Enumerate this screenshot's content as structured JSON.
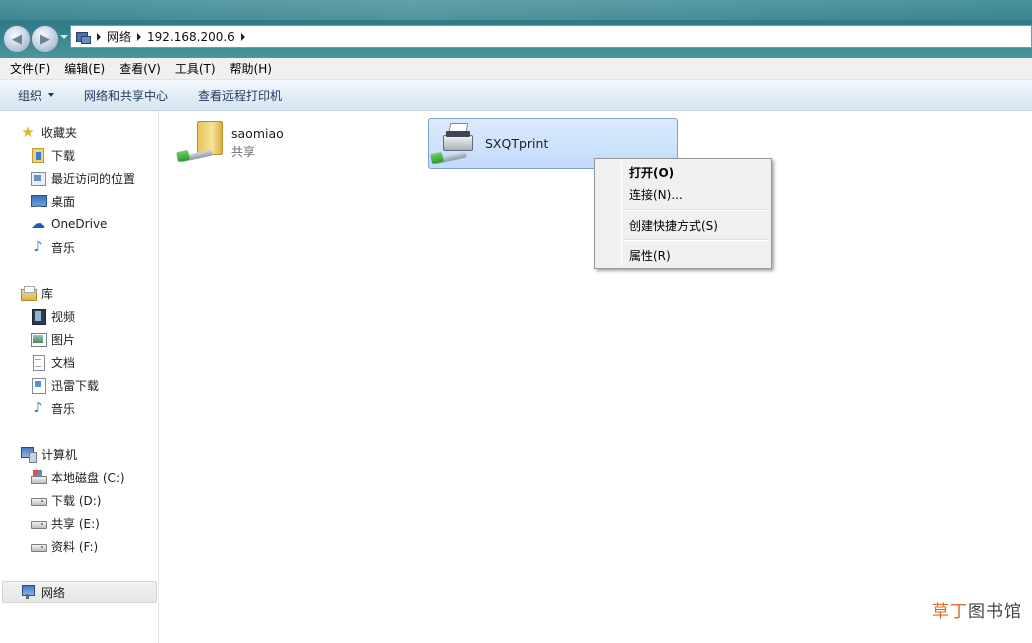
{
  "address": {
    "crumbs": [
      "网络",
      "192.168.200.6"
    ]
  },
  "menubar": {
    "items": [
      "文件(F)",
      "编辑(E)",
      "查看(V)",
      "工具(T)",
      "帮助(H)"
    ]
  },
  "toolbar": {
    "organize": "组织",
    "network_center": "网络和共享中心",
    "view_printers": "查看远程打印机"
  },
  "sidebar": {
    "favorites": {
      "label": "收藏夹",
      "items": [
        "下载",
        "最近访问的位置",
        "桌面",
        "OneDrive",
        "音乐"
      ]
    },
    "libraries": {
      "label": "库",
      "items": [
        "视频",
        "图片",
        "文档",
        "迅雷下载",
        "音乐"
      ]
    },
    "computer": {
      "label": "计算机",
      "items": [
        "本地磁盘 (C:)",
        "下载 (D:)",
        "共享 (E:)",
        "资料 (F:)"
      ]
    },
    "network": {
      "label": "网络"
    }
  },
  "content": {
    "items": [
      {
        "name": "saomiao",
        "sub": "共享",
        "icon": "shared-folder-icon"
      },
      {
        "name": "SXQTprint",
        "sub": "",
        "icon": "network-printer-icon"
      }
    ]
  },
  "context_menu": {
    "open": "打开(O)",
    "connect": "连接(N)...",
    "create_shortcut": "创建快捷方式(S)",
    "properties": "属性(R)"
  },
  "watermark": {
    "part1": "草丁",
    "part2": "图书馆"
  },
  "colors": {
    "title_bar": "#35838e",
    "selection": "#c1dbfc",
    "watermark_accent": "#e26a23"
  }
}
